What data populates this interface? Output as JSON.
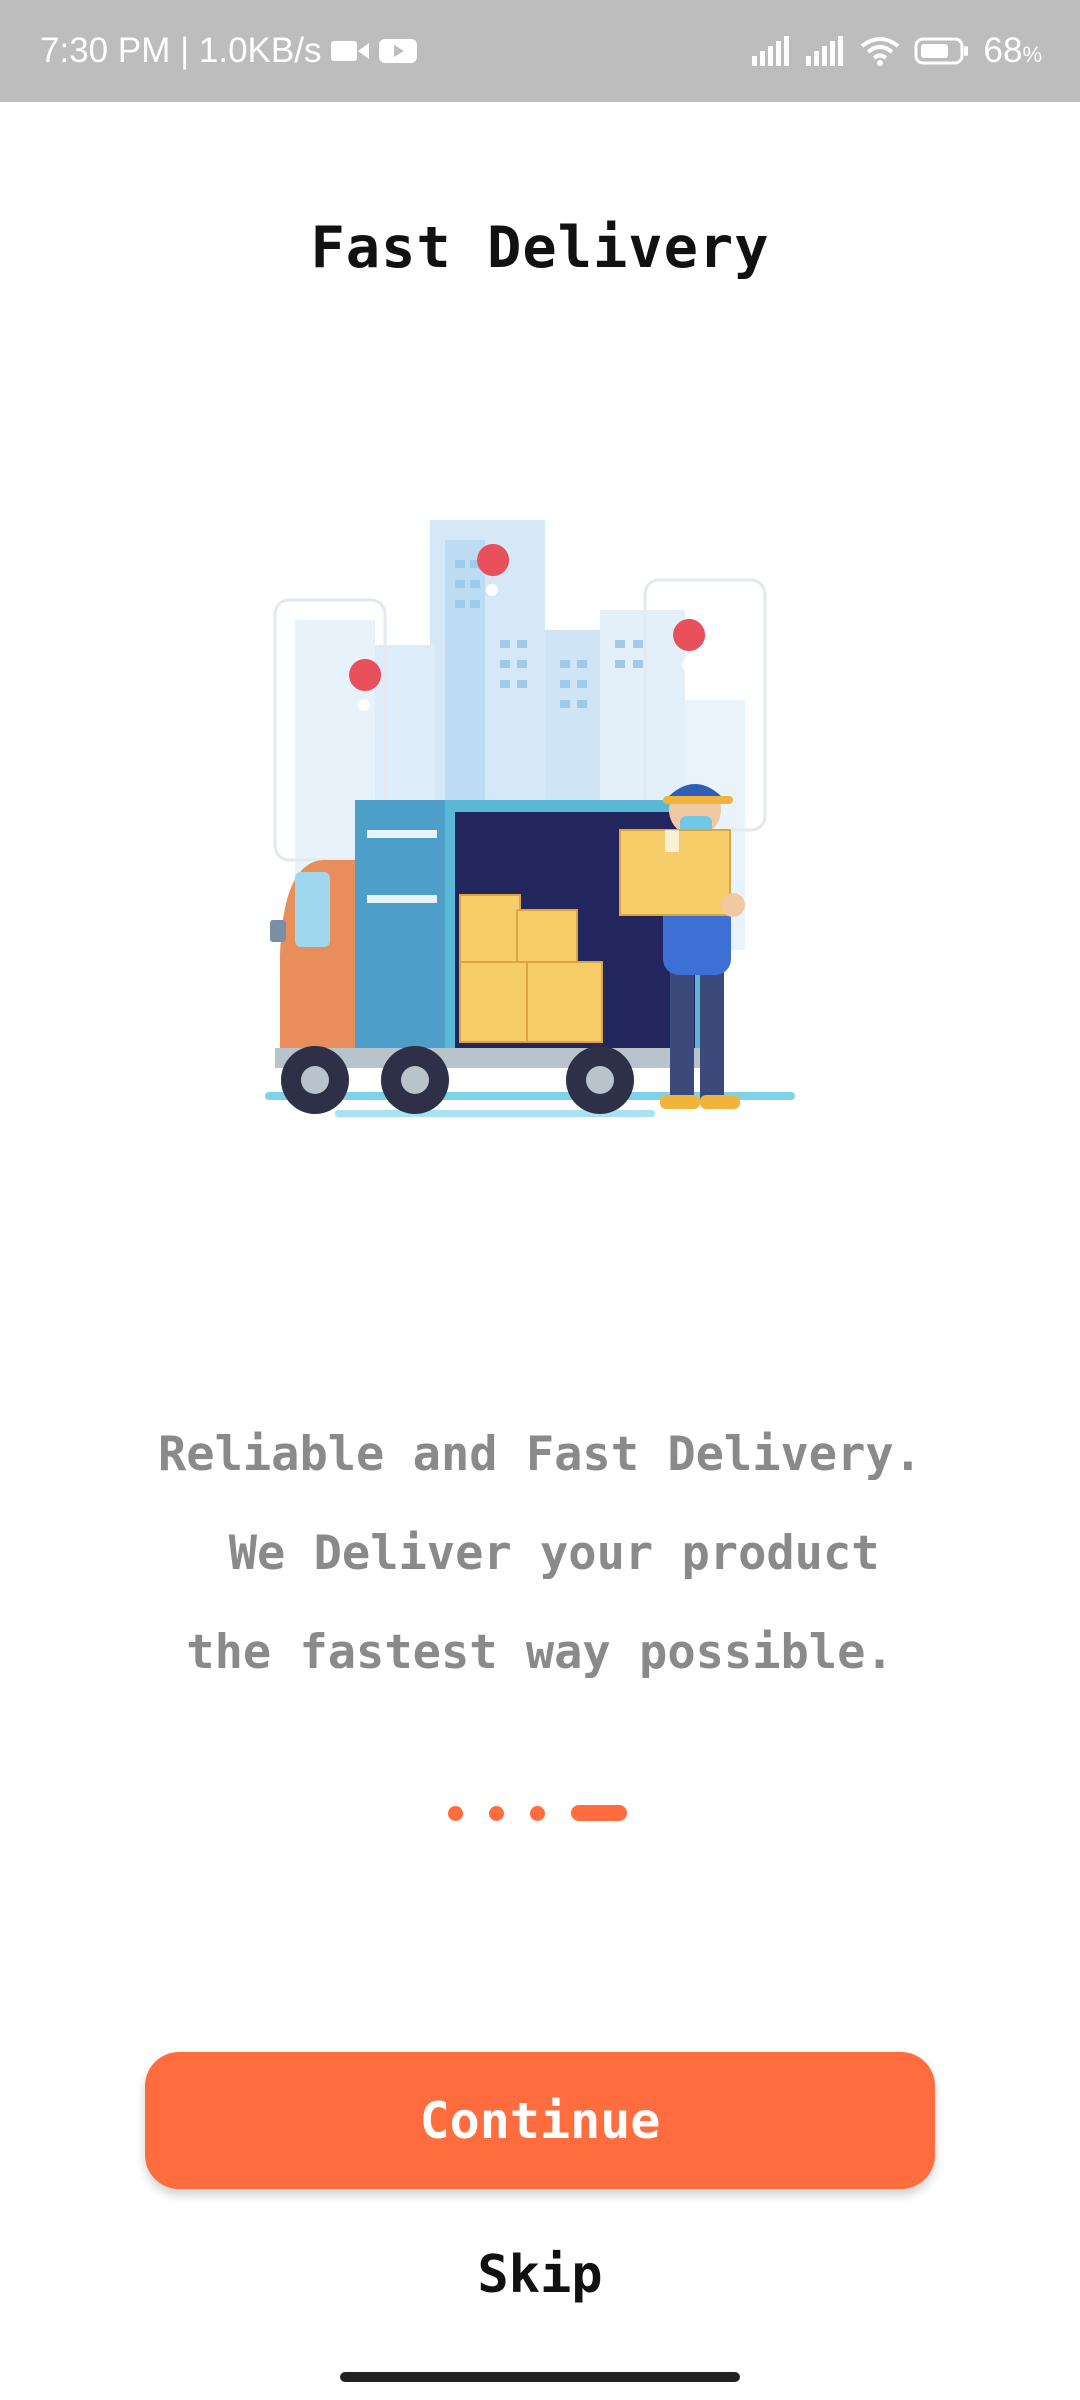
{
  "status_bar": {
    "time_speed": "7:30 PM | 1.0KB/s",
    "battery_percent": "68",
    "battery_unit": "%",
    "icons": [
      "video-camera-icon",
      "youtube-icon",
      "signal-icon",
      "signal-icon",
      "wifi-icon",
      "battery-icon"
    ]
  },
  "screen": {
    "title": "Fast Delivery",
    "illustration": "delivery-truck-illustration",
    "description_lines": [
      "Reliable and Fast Delivery.",
      " We Deliver your product",
      "the fastest way possible."
    ],
    "pager": {
      "total": 4,
      "active_index": 3
    },
    "continue_label": "Continue",
    "skip_label": "Skip"
  },
  "colors": {
    "accent": "#ff6d3f",
    "status_bar": "#bdbdbd",
    "description_text": "#8a8a8a"
  }
}
